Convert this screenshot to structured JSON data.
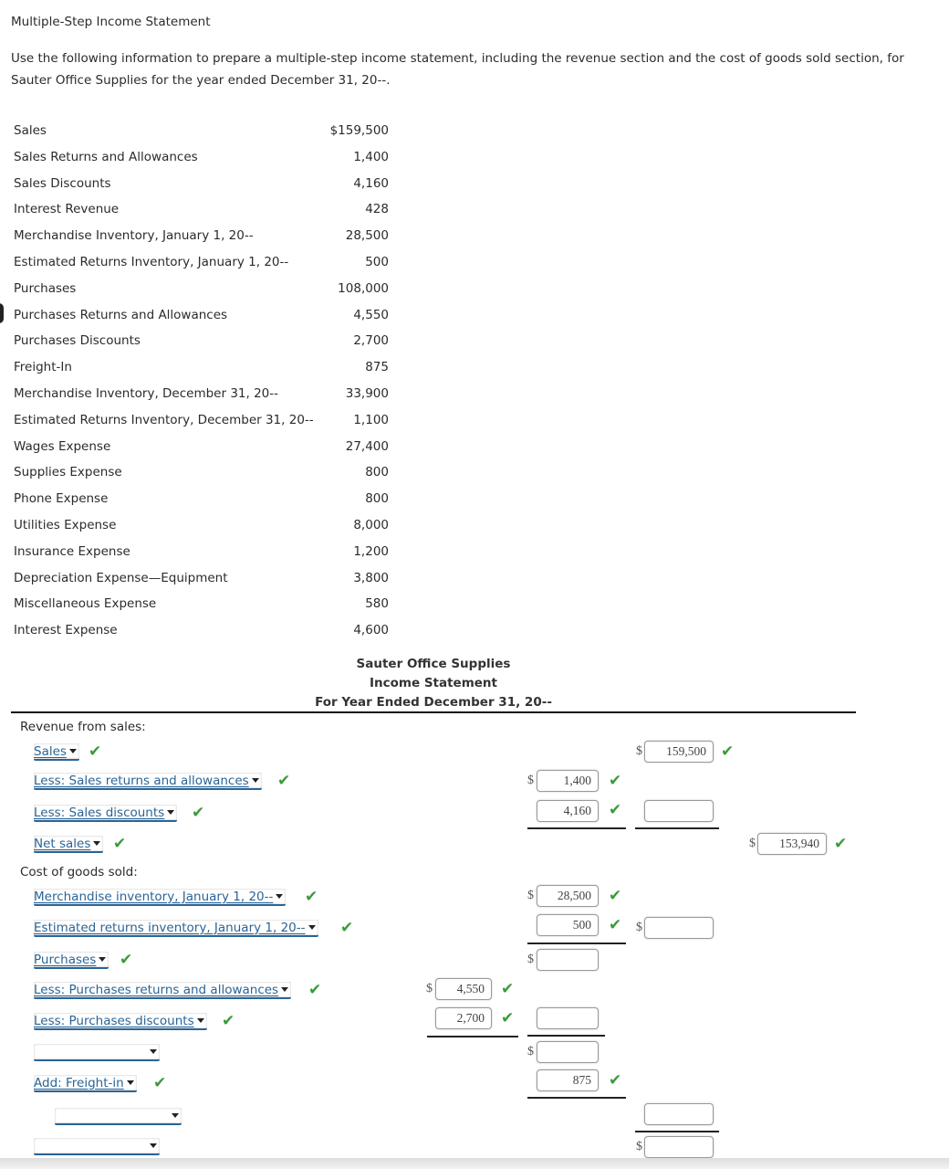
{
  "page": {
    "title": "Multiple-Step Income Statement",
    "instructions": "Use the following information to prepare a multiple-step income statement, including the revenue section and the cost of goods sold section, for Sauter Office Supplies for the year ended December 31, 20--."
  },
  "given_data": [
    {
      "label": "Sales",
      "value": "$159,500"
    },
    {
      "label": "Sales Returns and Allowances",
      "value": "1,400"
    },
    {
      "label": "Sales Discounts",
      "value": "4,160"
    },
    {
      "label": "Interest Revenue",
      "value": "428"
    },
    {
      "label": "Merchandise Inventory, January 1, 20--",
      "value": "28,500"
    },
    {
      "label": "Estimated Returns Inventory, January 1, 20--",
      "value": "500"
    },
    {
      "label": "Purchases",
      "value": "108,000"
    },
    {
      "label": "Purchases Returns and Allowances",
      "value": "4,550"
    },
    {
      "label": "Purchases Discounts",
      "value": "2,700"
    },
    {
      "label": "Freight-In",
      "value": "875"
    },
    {
      "label": "Merchandise Inventory, December 31, 20--",
      "value": "33,900"
    },
    {
      "label": "Estimated Returns Inventory, December 31, 20--",
      "value": "1,100"
    },
    {
      "label": "Wages Expense",
      "value": "27,400"
    },
    {
      "label": "Supplies Expense",
      "value": "800"
    },
    {
      "label": "Phone Expense",
      "value": "800"
    },
    {
      "label": "Utilities Expense",
      "value": "8,000"
    },
    {
      "label": "Insurance Expense",
      "value": "1,200"
    },
    {
      "label": "Depreciation Expense—Equipment",
      "value": "3,800"
    },
    {
      "label": "Miscellaneous Expense",
      "value": "580"
    },
    {
      "label": "Interest Expense",
      "value": "4,600"
    }
  ],
  "statement": {
    "company": "Sauter Office Supplies",
    "name": "Income Statement",
    "period": "For Year Ended December 31, 20--",
    "revenue_heading": "Revenue from sales:",
    "cogs_heading": "Cost of goods sold:",
    "currency_symbol": "$",
    "check_glyph": "✔",
    "check_color": "#3a9b3a",
    "rows": {
      "sales": {
        "select": "Sales",
        "amount": "159,500"
      },
      "sales_returns": {
        "select": "Less: Sales returns and allowances",
        "amount": "1,400"
      },
      "sales_discounts": {
        "select": "Less: Sales discounts",
        "amount": "4,160",
        "subtotal": ""
      },
      "net_sales": {
        "select": "Net sales",
        "amount": "153,940"
      },
      "merch_inv_jan": {
        "select": "Merchandise inventory, January 1, 20--",
        "amount": "28,500"
      },
      "est_returns_jan": {
        "select": "Estimated returns inventory, January 1, 20--",
        "amount": "500",
        "subtotal": ""
      },
      "purchases": {
        "select": "Purchases",
        "amount": ""
      },
      "purch_returns": {
        "select": "Less: Purchases returns and allowances",
        "amount": "4,550"
      },
      "purch_discounts": {
        "select": "Less: Purchases discounts",
        "amount": "2,700",
        "subtotal": ""
      },
      "blank_select_1": {
        "select": "",
        "amount": ""
      },
      "freight_in": {
        "select": "Add: Freight-in",
        "amount": "875"
      },
      "blank_select_2": {
        "select": "",
        "amount": ""
      },
      "blank_select_3": {
        "select": "",
        "amount": ""
      }
    }
  }
}
